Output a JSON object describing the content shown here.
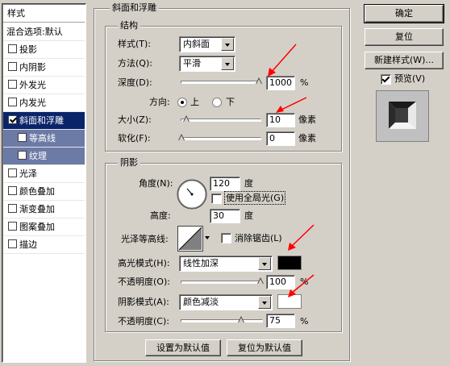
{
  "style_list": {
    "header": "样式",
    "items": [
      {
        "label": "混合选项:默认",
        "checkbox": false,
        "checked": false,
        "state": "normal"
      },
      {
        "label": "投影",
        "checkbox": true,
        "checked": false,
        "state": "normal"
      },
      {
        "label": "内阴影",
        "checkbox": true,
        "checked": false,
        "state": "normal"
      },
      {
        "label": "外发光",
        "checkbox": true,
        "checked": false,
        "state": "normal"
      },
      {
        "label": "内发光",
        "checkbox": true,
        "checked": false,
        "state": "normal"
      },
      {
        "label": "斜面和浮雕",
        "checkbox": true,
        "checked": true,
        "state": "selected"
      },
      {
        "label": "等高线",
        "checkbox": true,
        "checked": false,
        "state": "sub"
      },
      {
        "label": "纹理",
        "checkbox": true,
        "checked": false,
        "state": "sub"
      },
      {
        "label": "光泽",
        "checkbox": true,
        "checked": false,
        "state": "normal"
      },
      {
        "label": "颜色叠加",
        "checkbox": true,
        "checked": false,
        "state": "normal"
      },
      {
        "label": "渐变叠加",
        "checkbox": true,
        "checked": false,
        "state": "normal"
      },
      {
        "label": "图案叠加",
        "checkbox": true,
        "checked": false,
        "state": "normal"
      },
      {
        "label": "描边",
        "checkbox": true,
        "checked": false,
        "state": "normal"
      }
    ]
  },
  "bevel": {
    "title": "斜面和浮雕",
    "structure": {
      "title": "结构",
      "style_label": "样式(T):",
      "style_value": "内斜面",
      "technique_label": "方法(Q):",
      "technique_value": "平滑",
      "depth_label": "深度(D):",
      "depth_value": "1000",
      "depth_unit": "%",
      "depth_slider_fraction": 1.0,
      "direction_label": "方向:",
      "direction_up": "上",
      "direction_down": "下",
      "direction_selected": "上",
      "size_label": "大小(Z):",
      "size_value": "10",
      "size_unit": "像素",
      "size_slider_fraction": 0.04,
      "soften_label": "软化(F):",
      "soften_value": "0",
      "soften_unit": "像素",
      "soften_slider_fraction": 0.0
    },
    "shading": {
      "title": "阴影",
      "angle_label": "角度(N):",
      "angle_value": "120",
      "angle_unit": "度",
      "global_light_label": "使用全局光(G)",
      "global_light_checked": false,
      "altitude_label": "高度:",
      "altitude_value": "30",
      "altitude_unit": "度",
      "gloss_contour_label": "光泽等高线:",
      "anti_aliased_label": "消除锯齿(L)",
      "anti_aliased_checked": false,
      "highlight_mode_label": "高光模式(H):",
      "highlight_mode_value": "线性加深",
      "highlight_color": "#000000",
      "highlight_opacity_label": "不透明度(O):",
      "highlight_opacity_value": "100",
      "highlight_opacity_unit": "%",
      "highlight_opacity_fraction": 1.0,
      "shadow_mode_label": "阴影模式(A):",
      "shadow_mode_value": "颜色减淡",
      "shadow_color": "#ffffff",
      "shadow_opacity_label": "不透明度(C):",
      "shadow_opacity_value": "75",
      "shadow_opacity_unit": "%",
      "shadow_opacity_fraction": 0.75
    },
    "make_default_label": "设置为默认值",
    "reset_default_label": "复位为默认值"
  },
  "buttons": {
    "ok": "确定",
    "reset": "复位",
    "new_style": "新建样式(W)...",
    "preview_label": "预览(V)",
    "preview_checked": true
  },
  "colors": {
    "dialog_bg": "#d4d0c8",
    "selected_bg": "#0a246a",
    "sub_bg": "#6c7aa6",
    "annotation_arrow": "#ff0000"
  }
}
